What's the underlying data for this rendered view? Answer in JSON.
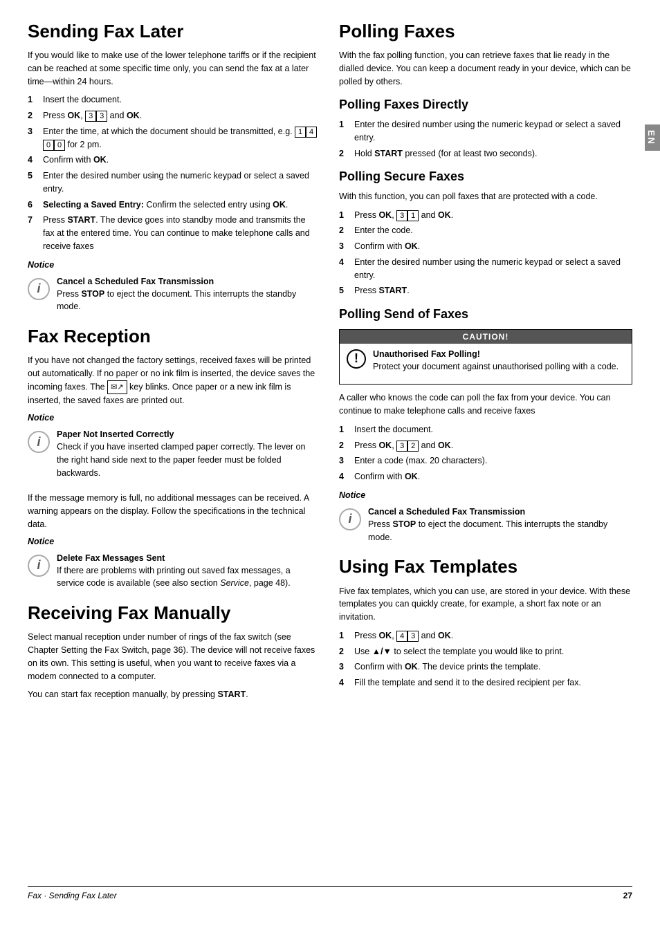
{
  "page": {
    "en_label": "EN",
    "footer": {
      "left": "Fax · Sending Fax Later",
      "right": "27"
    }
  },
  "left_col": {
    "section1": {
      "title": "Sending Fax Later",
      "intro": "If you would like to make use of the lower telephone tariffs or if the recipient can be reached at some specific time only, you can send the fax at a later time—within 24 hours.",
      "steps": [
        {
          "num": "1",
          "text": "Insert the document."
        },
        {
          "num": "2",
          "text_parts": [
            "Press ",
            "OK",
            ", ",
            "3",
            "3",
            " and ",
            "OK",
            "."
          ]
        },
        {
          "num": "3",
          "text_parts": [
            "Enter the time, at which the document should be transmitted, e.g. ",
            "1",
            "4",
            "0",
            "0",
            " for 2 pm."
          ]
        },
        {
          "num": "4",
          "text_parts": [
            "Confirm with ",
            "OK",
            "."
          ]
        },
        {
          "num": "5",
          "text": "Enter the desired number using the numeric keypad or select a saved entry."
        },
        {
          "num": "6",
          "text_parts": [
            "Selecting a Saved Entry:",
            " Confirm the selected entry using ",
            "OK",
            "."
          ]
        },
        {
          "num": "7",
          "text_parts": [
            "Press ",
            "START",
            ". The device goes into standby mode and transmits the fax at the entered time. You can continue to make telephone calls and receive faxes"
          ]
        }
      ],
      "notice": {
        "label": "Notice",
        "title": "Cancel a Scheduled Fax Transmission",
        "text_parts": [
          "Press ",
          "STOP",
          " to eject the document. This interrupts the standby mode."
        ]
      }
    },
    "section2": {
      "title": "Fax Reception",
      "intro": "If you have not changed the factory settings, received faxes will be printed out automatically. If no paper or no ink film is inserted, the device saves the incoming faxes.  The",
      "intro2": "key blinks. Once paper or a new ink film is inserted, the saved faxes are printed out.",
      "notice1": {
        "label": "Notice",
        "title": "Paper Not Inserted Correctly",
        "text": "Check if you have inserted clamped paper correctly. The lever on the right hand side next to the paper feeder must be folded backwards."
      },
      "para": "If the message memory is full, no additional messages can be received. A warning appears on the display. Follow the specifications in the technical data.",
      "notice2": {
        "label": "Notice",
        "title": "Delete Fax Messages Sent",
        "text_parts": [
          "If there are problems with printing out saved fax messages, a service code is available (see also section ",
          "Service",
          ", page 48)."
        ]
      }
    },
    "section3": {
      "title": "Receiving Fax Manually",
      "para1": "Select manual reception under number of rings of the fax switch (see Chapter Setting the Fax Switch, page 36). The device will not receive faxes on its own. This setting is useful, when you want to receive faxes via a modem connected to a computer.",
      "para2": [
        "You can start fax reception manually, by pressing ",
        "START",
        "."
      ]
    }
  },
  "right_col": {
    "section1": {
      "title": "Polling Faxes",
      "intro": "With the fax polling function, you can retrieve faxes that lie ready in the dialled device.  You can keep a document ready in your device, which can be polled by others."
    },
    "section2": {
      "title": "Polling Faxes Directly",
      "steps": [
        {
          "num": "1",
          "text": "Enter the desired number using the numeric keypad or select a saved entry."
        },
        {
          "num": "2",
          "text_parts": [
            "Hold ",
            "START",
            " pressed (for at least two seconds)."
          ]
        }
      ]
    },
    "section3": {
      "title": "Polling Secure Faxes",
      "intro": "With this function, you can poll faxes that are protected with a code.",
      "steps": [
        {
          "num": "1",
          "text_parts": [
            "Press ",
            "OK",
            ", ",
            "3",
            "1",
            " and ",
            "OK",
            "."
          ]
        },
        {
          "num": "2",
          "text": "Enter the code."
        },
        {
          "num": "3",
          "text_parts": [
            "Confirm with ",
            "OK",
            "."
          ]
        },
        {
          "num": "4",
          "text": "Enter the desired number using the numeric keypad or select a saved entry."
        },
        {
          "num": "5",
          "text_parts": [
            "Press ",
            "START",
            "."
          ]
        }
      ]
    },
    "section4": {
      "title": "Polling Send of Faxes",
      "caution": {
        "header": "CAUTION!",
        "title": "Unauthorised Fax Polling!",
        "text": "Protect your document against unauthorised polling with a code."
      },
      "para": "A caller who knows the code can poll the fax from your device. You can continue to make telephone calls and receive faxes",
      "steps": [
        {
          "num": "1",
          "text": "Insert the document."
        },
        {
          "num": "2",
          "text_parts": [
            "Press ",
            "OK",
            ", ",
            "3",
            "2",
            " and ",
            "OK",
            "."
          ]
        },
        {
          "num": "3",
          "text": "Enter a code (max. 20 characters)."
        },
        {
          "num": "4",
          "text_parts": [
            "Confirm with ",
            "OK",
            "."
          ]
        }
      ],
      "notice": {
        "label": "Notice",
        "title": "Cancel a Scheduled Fax Transmission",
        "text_parts": [
          "Press ",
          "STOP",
          " to eject the document. This interrupts the standby mode."
        ]
      }
    },
    "section5": {
      "title": "Using Fax Templates",
      "intro": "Five fax templates, which you can use, are stored in your device. With these templates you can quickly create, for example, a short fax note or an invitation.",
      "steps": [
        {
          "num": "1",
          "text_parts": [
            "Press ",
            "OK",
            ", ",
            "4",
            "3",
            " and ",
            "OK",
            "."
          ]
        },
        {
          "num": "2",
          "text_parts": [
            "Use ",
            "▲/▼",
            " to select the template you would like to print."
          ]
        },
        {
          "num": "3",
          "text_parts": [
            "Confirm with ",
            "OK",
            ". The device prints the template."
          ]
        },
        {
          "num": "4",
          "text": "Fill the template and send it to the desired recipient per fax."
        }
      ]
    }
  }
}
